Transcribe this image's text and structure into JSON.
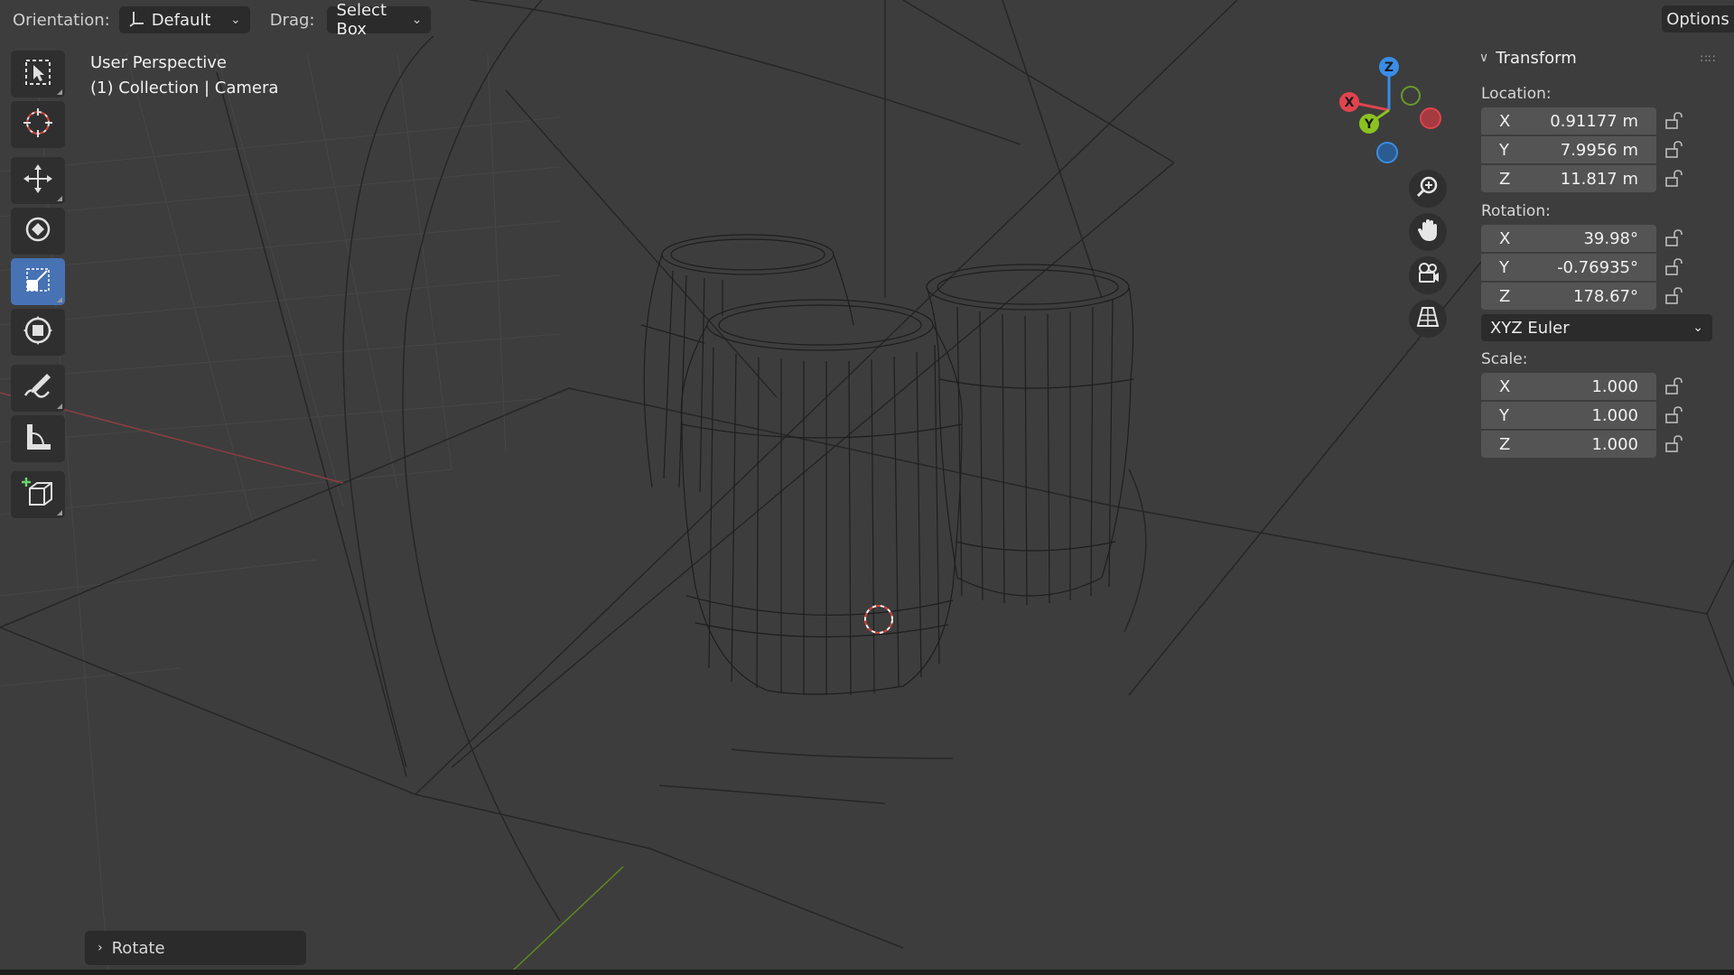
{
  "header": {
    "orientation_label": "Orientation:",
    "orientation_value": "Default",
    "drag_label": "Drag:",
    "drag_value": "Select Box",
    "options_label": "Options"
  },
  "viewport": {
    "view_name": "User Perspective",
    "collection_info": "(1) Collection | Camera"
  },
  "toolbar": {
    "tools": [
      "select-box",
      "cursor",
      "move",
      "rotate",
      "scale",
      "transform",
      "annotate",
      "measure",
      "add-cube"
    ],
    "active_tool": "scale"
  },
  "gizmo": {
    "axes": [
      "X",
      "Y",
      "Z"
    ],
    "colors": {
      "x": "#e0444e",
      "y": "#8bc220",
      "z": "#3a8de6"
    }
  },
  "nav_buttons": [
    "zoom-icon",
    "hand-pan-icon",
    "camera-view-icon",
    "perspective-grid-icon"
  ],
  "transform": {
    "title": "Transform",
    "location_label": "Location:",
    "location": [
      {
        "axis": "X",
        "value": "0.91177 m"
      },
      {
        "axis": "Y",
        "value": "7.9956 m"
      },
      {
        "axis": "Z",
        "value": "11.817 m"
      }
    ],
    "rotation_label": "Rotation:",
    "rotation": [
      {
        "axis": "X",
        "value": "39.98°"
      },
      {
        "axis": "Y",
        "value": "-0.76935°"
      },
      {
        "axis": "Z",
        "value": "178.67°"
      }
    ],
    "rotation_mode": "XYZ Euler",
    "scale_label": "Scale:",
    "scale": [
      {
        "axis": "X",
        "value": "1.000"
      },
      {
        "axis": "Y",
        "value": "1.000"
      },
      {
        "axis": "Z",
        "value": "1.000"
      }
    ]
  },
  "operator_panel": {
    "label": "Rotate"
  }
}
